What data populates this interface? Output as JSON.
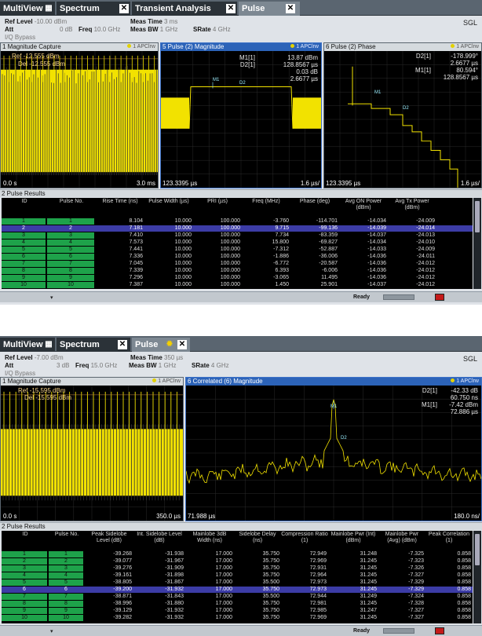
{
  "s1": {
    "tabs": [
      "MultiView",
      "Spectrum",
      "Transient Analysis",
      "Pulse"
    ],
    "sgl": "SGL",
    "params": {
      "ref_label": "Ref Level",
      "ref_val": "-10.00 dBm",
      "meas_time_label": "Meas Time",
      "meas_time_val": "3 ms",
      "att_label": "Att",
      "att_val": "0 dB",
      "freq_label": "Freq",
      "freq_val": "10.0 GHz",
      "meas_bw_label": "Meas BW",
      "meas_bw_val": "1 GHz",
      "srate_label": "SRate",
      "srate_val": "4 GHz",
      "iq": "I/Q Bypass"
    },
    "p1": {
      "title": "1 Magnitude Capture",
      "trace": "1 APClrw",
      "ref": "Ref -12.555 dBm",
      "del": "Del -12.555 dBm",
      "x_left": "0.0 s",
      "x_right": "3.0 ms"
    },
    "p5": {
      "title": "5 Pulse (2) Magnitude",
      "trace": "1 APClrw",
      "m_lbl": "M1[1]",
      "m_val1": "13.87 dBm",
      "m_val2": "128.8567 µs",
      "d_lbl": "D2[1]",
      "d_val1": "0.03 dB",
      "d_val2": "2.6677 µs",
      "x_left": "123.3395 µs",
      "x_right": "1.6 µs/",
      "mk1": "M1",
      "mk2": "D2"
    },
    "p6": {
      "title": "6 Pulse (2) Phase",
      "trace": "1 APClrw",
      "d_lbl": "D2[1]",
      "d_val1": "-178.999°",
      "d_val2": "2.6677 µs",
      "m_lbl": "M1[1]",
      "m_val1": "80.594°",
      "m_val2": "128.8567 µs",
      "x_left": "123.3395 µs",
      "x_right": "1.6 µs/",
      "mk1": "M1",
      "mk2": "D2"
    },
    "results": {
      "title": "2 Pulse Results",
      "headers": [
        "ID",
        "Pulse No.",
        "Rise Time (ns)",
        "Pulse Width (µs)",
        "PRI (µs)",
        "Freq (MHz)",
        "Phase (deg)",
        "Avg ON Power (dBm)",
        "Avg Tx Power (dBm)"
      ],
      "rows": [
        [
          "1",
          "1",
          "8.104",
          "10.000",
          "100.000",
          "-3.760",
          "-114.701",
          "-14.034",
          "-24.009"
        ],
        [
          "2",
          "2",
          "7.181",
          "10.000",
          "100.000",
          "9.715",
          "-99.136",
          "-14.039",
          "-24.014"
        ],
        [
          "3",
          "3",
          "7.410",
          "10.000",
          "100.000",
          "7.734",
          "-83.359",
          "-14.037",
          "-24.013"
        ],
        [
          "4",
          "4",
          "7.573",
          "10.000",
          "100.000",
          "15.800",
          "-69.827",
          "-14.034",
          "-24.010"
        ],
        [
          "5",
          "5",
          "7.441",
          "10.000",
          "100.000",
          "-7.312",
          "-52.887",
          "-14.033",
          "-24.009"
        ],
        [
          "6",
          "6",
          "7.336",
          "10.000",
          "100.000",
          "-1.886",
          "-36.006",
          "-14.036",
          "-24.011"
        ],
        [
          "7",
          "7",
          "7.045",
          "10.000",
          "100.000",
          "-6.772",
          "-20.587",
          "-14.036",
          "-24.012"
        ],
        [
          "8",
          "8",
          "7.339",
          "10.000",
          "100.000",
          "6.393",
          "-6.006",
          "-14.036",
          "-24.012"
        ],
        [
          "9",
          "9",
          "7.296",
          "10.000",
          "100.000",
          "-3.065",
          "11.495",
          "-14.036",
          "-24.012"
        ],
        [
          "10",
          "10",
          "7.387",
          "10.000",
          "100.000",
          "1.450",
          "25.901",
          "-14.037",
          "-24.012"
        ]
      ],
      "selected": 1
    },
    "status": "Ready"
  },
  "s2": {
    "tabs": [
      "MultiView",
      "Spectrum",
      "Pulse"
    ],
    "sgl": "SGL",
    "params": {
      "ref_label": "Ref Level",
      "ref_val": "-7.00 dBm",
      "meas_time_label": "Meas Time",
      "meas_time_val": "350 µs",
      "att_label": "Att",
      "att_val": "3 dB",
      "freq_label": "Freq",
      "freq_val": "15.0 GHz",
      "meas_bw_label": "Meas BW",
      "meas_bw_val": "1 GHz",
      "srate_label": "SRate",
      "srate_val": "4 GHz",
      "iq": "I/Q Bypass"
    },
    "p1": {
      "title": "1 Magnitude Capture",
      "trace": "1 APClrw",
      "ref": "Ref -15.595 dBm",
      "del": "Del -15.595 dBm",
      "x_left": "0.0 s",
      "x_right": "350.0 µs"
    },
    "p6": {
      "title": "6 Correlated (6) Magnitude",
      "trace": "1 APClrw",
      "d_lbl": "D2[1]",
      "d_val1": "-42.33 dB",
      "d_val2": "60.750 ns",
      "m_lbl": "M1[1]",
      "m_val1": "-7.42 dBm",
      "m_val2": "72.886 µs",
      "x_left": "71.988 µs",
      "x_right": "180.0 ns/",
      "mk1": "M1",
      "mk2": "D2"
    },
    "results": {
      "title": "2 Pulse Results",
      "headers": [
        "ID",
        "Pulse No.",
        "Peak Sidelobe Level (dB)",
        "Int. Sidelobe Level (dB)",
        "Mainlobe 3dB Width (ns)",
        "Sidelobe Delay (ns)",
        "Compression Ratio (1)",
        "Mainlobe Pwr (Int) (dBm)",
        "Mainlobe Pwr (Avg) (dBm)",
        "Peak Correlation (1)"
      ],
      "rows": [
        [
          "1",
          "1",
          "-39.268",
          "-31.938",
          "17.000",
          "35.750",
          "72.949",
          "31.248",
          "-7.325",
          "0.858"
        ],
        [
          "2",
          "2",
          "-39.077",
          "-31.967",
          "17.000",
          "35.750",
          "72.969",
          "31.245",
          "-7.323",
          "0.858"
        ],
        [
          "3",
          "3",
          "-39.276",
          "-31.909",
          "17.000",
          "35.750",
          "72.931",
          "31.245",
          "-7.326",
          "0.858"
        ],
        [
          "4",
          "4",
          "-39.161",
          "-31.898",
          "17.000",
          "35.750",
          "72.964",
          "31.245",
          "-7.327",
          "0.858"
        ],
        [
          "5",
          "5",
          "-38.805",
          "-31.867",
          "17.000",
          "35.500",
          "72.973",
          "31.245",
          "-7.329",
          "0.858"
        ],
        [
          "6",
          "6",
          "-39.200",
          "-31.932",
          "17.000",
          "35.750",
          "72.973",
          "31.245",
          "-7.329",
          "0.858"
        ],
        [
          "7",
          "7",
          "-38.871",
          "-31.843",
          "17.000",
          "35.500",
          "72.944",
          "31.249",
          "-7.324",
          "0.858"
        ],
        [
          "8",
          "8",
          "-38.996",
          "-31.880",
          "17.000",
          "35.750",
          "72.981",
          "31.245",
          "-7.328",
          "0.858"
        ],
        [
          "9",
          "9",
          "-39.129",
          "-31.932",
          "17.000",
          "35.750",
          "72.985",
          "31.247",
          "-7.327",
          "0.858"
        ],
        [
          "10",
          "10",
          "-39.282",
          "-31.932",
          "17.000",
          "35.750",
          "72.969",
          "31.245",
          "-7.327",
          "0.858"
        ]
      ],
      "selected": 5
    },
    "status": "Ready"
  },
  "colors": {
    "trace": "#f2e200",
    "selected_row": "#3c3ca6",
    "id_cell": "#1ea24a",
    "panel_active": "#2c63b8"
  }
}
